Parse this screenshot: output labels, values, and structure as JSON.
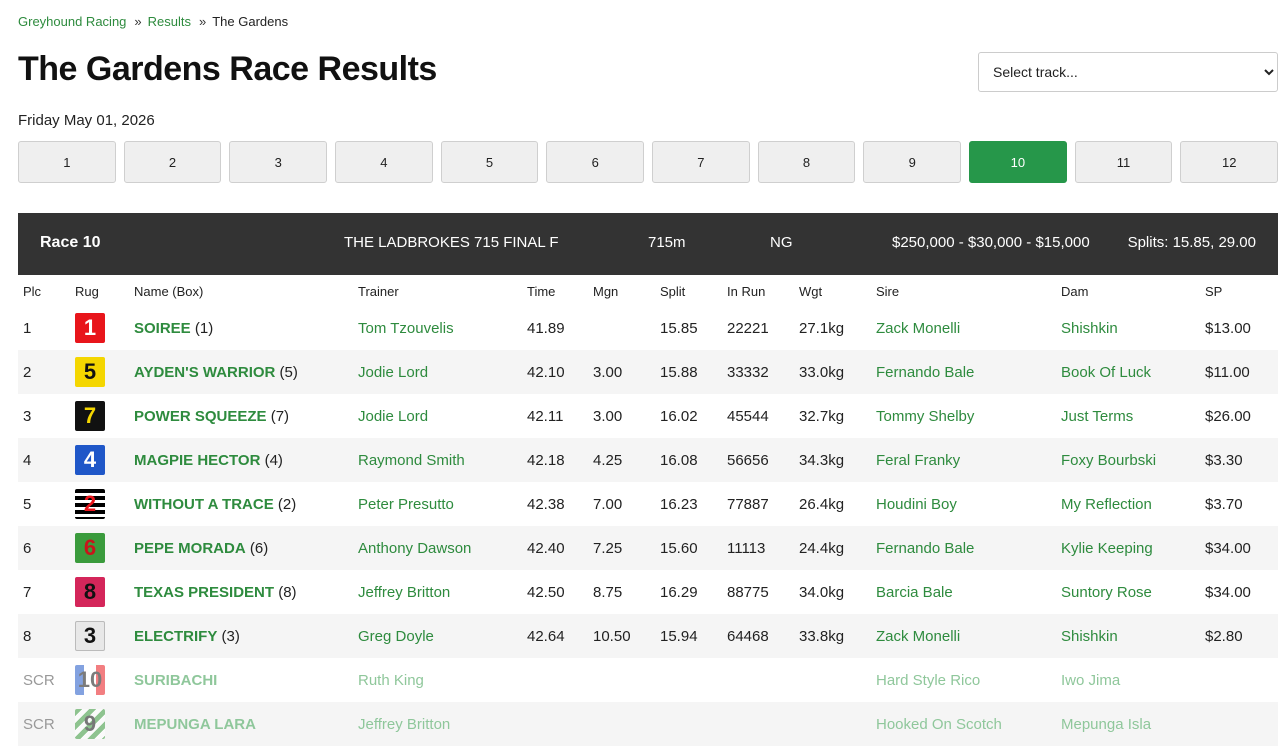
{
  "breadcrumb": {
    "home": "Greyhound Racing",
    "results": "Results",
    "current": "The Gardens",
    "sep": "»"
  },
  "page_title": "The Gardens Race Results",
  "track_select": {
    "selected": "Select track..."
  },
  "race_date": "Friday May 01, 2026",
  "race_tabs": [
    "1",
    "2",
    "3",
    "4",
    "5",
    "6",
    "7",
    "8",
    "9",
    "10",
    "11",
    "12"
  ],
  "active_race": "10",
  "race": {
    "label": "Race 10",
    "name": "THE LADBROKES 715 FINAL F",
    "distance": "715m",
    "grade": "NG",
    "prize": "$250,000 - $30,000 - $15,000",
    "splits": "Splits: 15.85, 29.00"
  },
  "columns": [
    "Plc",
    "Rug",
    "Name (Box)",
    "Trainer",
    "Time",
    "Mgn",
    "Split",
    "In Run",
    "Wgt",
    "Sire",
    "Dam",
    "SP"
  ],
  "runners": [
    {
      "plc": "1",
      "rug": "1",
      "name": "SOIREE",
      "box": "(1)",
      "trainer": "Tom Tzouvelis",
      "time": "41.89",
      "mgn": "",
      "split": "15.85",
      "inrun": "22221",
      "wgt": "27.1kg",
      "sire": "Zack Monelli",
      "dam": "Shishkin",
      "sp": "$13.00"
    },
    {
      "plc": "2",
      "rug": "5",
      "name": "AYDEN'S WARRIOR",
      "box": "(5)",
      "trainer": "Jodie Lord",
      "time": "42.10",
      "mgn": "3.00",
      "split": "15.88",
      "inrun": "33332",
      "wgt": "33.0kg",
      "sire": "Fernando Bale",
      "dam": "Book Of Luck",
      "sp": "$11.00"
    },
    {
      "plc": "3",
      "rug": "7",
      "name": "POWER SQUEEZE",
      "box": "(7)",
      "trainer": "Jodie Lord",
      "time": "42.11",
      "mgn": "3.00",
      "split": "16.02",
      "inrun": "45544",
      "wgt": "32.7kg",
      "sire": "Tommy Shelby",
      "dam": "Just Terms",
      "sp": "$26.00"
    },
    {
      "plc": "4",
      "rug": "4",
      "name": "MAGPIE HECTOR",
      "box": "(4)",
      "trainer": "Raymond Smith",
      "time": "42.18",
      "mgn": "4.25",
      "split": "16.08",
      "inrun": "56656",
      "wgt": "34.3kg",
      "sire": "Feral Franky",
      "dam": "Foxy Bourbski",
      "sp": "$3.30"
    },
    {
      "plc": "5",
      "rug": "2",
      "name": "WITHOUT A TRACE",
      "box": "(2)",
      "trainer": "Peter Presutto",
      "time": "42.38",
      "mgn": "7.00",
      "split": "16.23",
      "inrun": "77887",
      "wgt": "26.4kg",
      "sire": "Houdini Boy",
      "dam": "My Reflection",
      "sp": "$3.70"
    },
    {
      "plc": "6",
      "rug": "6",
      "name": "PEPE MORADA",
      "box": "(6)",
      "trainer": "Anthony Dawson",
      "time": "42.40",
      "mgn": "7.25",
      "split": "15.60",
      "inrun": "11113",
      "wgt": "24.4kg",
      "sire": "Fernando Bale",
      "dam": "Kylie Keeping",
      "sp": "$34.00"
    },
    {
      "plc": "7",
      "rug": "8",
      "name": "TEXAS PRESIDENT",
      "box": "(8)",
      "trainer": "Jeffrey Britton",
      "time": "42.50",
      "mgn": "8.75",
      "split": "16.29",
      "inrun": "88775",
      "wgt": "34.0kg",
      "sire": "Barcia Bale",
      "dam": "Suntory Rose",
      "sp": "$34.00"
    },
    {
      "plc": "8",
      "rug": "3",
      "name": "ELECTRIFY",
      "box": "(3)",
      "trainer": "Greg Doyle",
      "time": "42.64",
      "mgn": "10.50",
      "split": "15.94",
      "inrun": "64468",
      "wgt": "33.8kg",
      "sire": "Zack Monelli",
      "dam": "Shishkin",
      "sp": "$2.80"
    },
    {
      "plc": "SCR",
      "rug": "10",
      "name": "SURIBACHI",
      "box": "",
      "trainer": "Ruth King",
      "time": "",
      "mgn": "",
      "split": "",
      "inrun": "",
      "wgt": "",
      "sire": "Hard Style Rico",
      "dam": "Iwo Jima",
      "sp": ""
    },
    {
      "plc": "SCR",
      "rug": "9",
      "name": "MEPUNGA LARA",
      "box": "",
      "trainer": "Jeffrey Britton",
      "time": "",
      "mgn": "",
      "split": "",
      "inrun": "",
      "wgt": "",
      "sire": "Hooked On Scotch",
      "dam": "Mepunga Isla",
      "sp": ""
    }
  ]
}
